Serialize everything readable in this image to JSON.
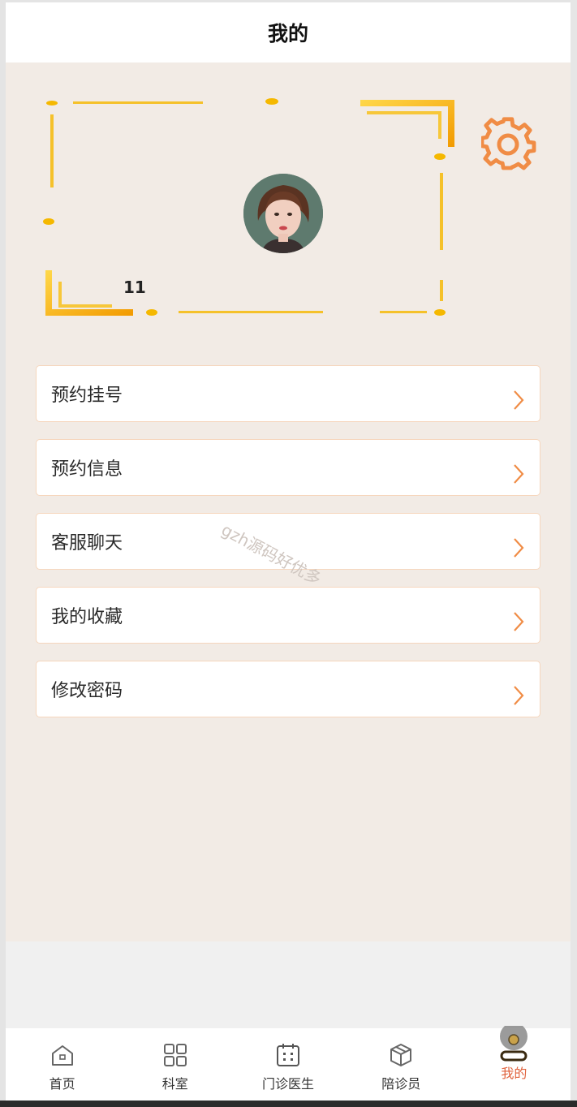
{
  "header": {
    "title": "我的"
  },
  "profile": {
    "username": "11"
  },
  "menu": {
    "items": [
      {
        "label": "预约挂号"
      },
      {
        "label": "预约信息"
      },
      {
        "label": "客服聊天"
      },
      {
        "label": "我的收藏"
      },
      {
        "label": "修改密码"
      }
    ]
  },
  "watermark": {
    "text": "gzh源码好优多"
  },
  "tabbar": {
    "items": [
      {
        "label": "首页",
        "icon": "home-icon"
      },
      {
        "label": "科室",
        "icon": "grid-icon"
      },
      {
        "label": "门诊医生",
        "icon": "calendar-icon"
      },
      {
        "label": "陪诊员",
        "icon": "box-icon"
      },
      {
        "label": "我的",
        "icon": "user-icon",
        "active": true
      }
    ]
  },
  "colors": {
    "accent": "#f08c45",
    "active_tab": "#e0623d",
    "frame_gold": "#f5b800",
    "background": "#f2ebe5"
  }
}
